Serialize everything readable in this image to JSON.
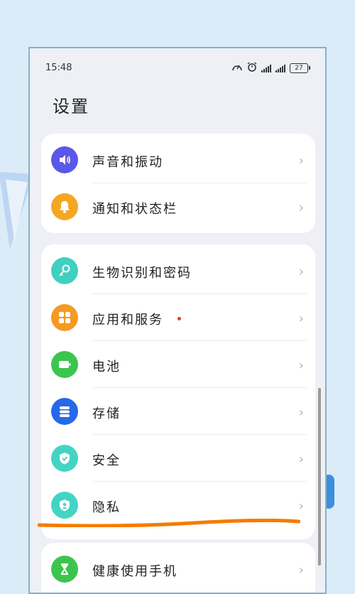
{
  "status_bar": {
    "time": "15:48",
    "battery": "27"
  },
  "page_title": "设置",
  "groups": [
    {
      "items": [
        {
          "label": "声音和振动",
          "icon": "speaker-icon",
          "color": "#5b57e8"
        },
        {
          "label": "通知和状态栏",
          "icon": "bell-icon",
          "color": "#f5a623"
        }
      ]
    },
    {
      "items": [
        {
          "label": "生物识别和密码",
          "icon": "key-icon",
          "color": "#3fd0be"
        },
        {
          "label": "应用和服务",
          "icon": "apps-icon",
          "color": "#f59a23",
          "badge": "red-dot"
        },
        {
          "label": "电池",
          "icon": "battery-icon",
          "color": "#3cc54e"
        },
        {
          "label": "存储",
          "icon": "storage-icon",
          "color": "#2669e8"
        },
        {
          "label": "安全",
          "icon": "shield-icon",
          "color": "#44d4c3"
        },
        {
          "label": "隐私",
          "icon": "privacy-icon",
          "color": "#44d4c3"
        }
      ]
    },
    {
      "items": [
        {
          "label": "健康使用手机",
          "icon": "hourglass-icon",
          "color": "#3cc54e"
        }
      ]
    }
  ],
  "annotation_color": "#f57c00"
}
